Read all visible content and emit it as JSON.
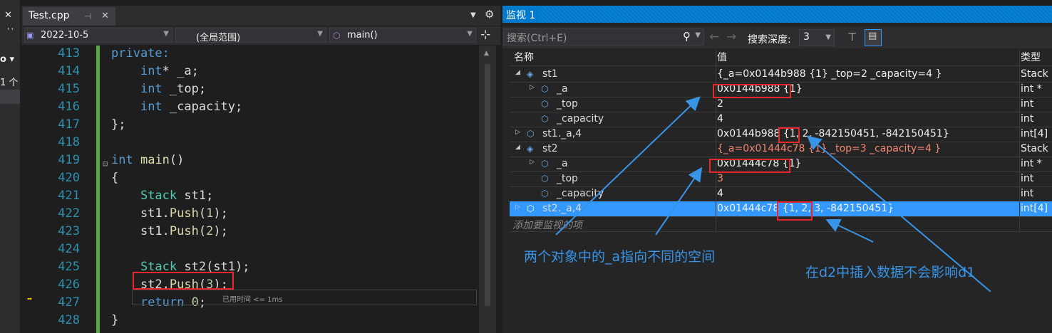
{
  "left_strip": {
    "glyph1": "✕",
    "glyph2": "' '",
    "glyph3": "o ▾",
    "glyph4": "1 个"
  },
  "editor": {
    "tab_title": "Test.cpp",
    "tab_pin": "⊣",
    "tab_close": "✕",
    "nav_file": "2022-10-5",
    "nav_scope": "(全局范围)",
    "nav_func": "main()",
    "lines": [
      {
        "num": "413",
        "segs": [
          {
            "t": "private:",
            "c": "kw"
          }
        ]
      },
      {
        "num": "414",
        "segs": [
          {
            "t": "    ",
            "c": ""
          },
          {
            "t": "int",
            "c": "kw"
          },
          {
            "t": "* _a;",
            "c": ""
          }
        ]
      },
      {
        "num": "415",
        "segs": [
          {
            "t": "    ",
            "c": ""
          },
          {
            "t": "int",
            "c": "kw"
          },
          {
            "t": " _top;",
            "c": ""
          }
        ]
      },
      {
        "num": "416",
        "segs": [
          {
            "t": "    ",
            "c": ""
          },
          {
            "t": "int",
            "c": "kw"
          },
          {
            "t": " _capacity;",
            "c": ""
          }
        ]
      },
      {
        "num": "417",
        "segs": [
          {
            "t": "};",
            "c": ""
          }
        ]
      },
      {
        "num": "418",
        "segs": []
      },
      {
        "num": "419",
        "segs": [
          {
            "t": "int",
            "c": "kw"
          },
          {
            "t": " ",
            "c": ""
          },
          {
            "t": "main",
            "c": "fn"
          },
          {
            "t": "()",
            "c": ""
          }
        ]
      },
      {
        "num": "420",
        "segs": [
          {
            "t": "{",
            "c": ""
          }
        ]
      },
      {
        "num": "421",
        "segs": [
          {
            "t": "    ",
            "c": ""
          },
          {
            "t": "Stack",
            "c": "ty"
          },
          {
            "t": " st1;",
            "c": ""
          }
        ]
      },
      {
        "num": "422",
        "segs": [
          {
            "t": "    st1.",
            "c": ""
          },
          {
            "t": "Push",
            "c": "fn"
          },
          {
            "t": "(",
            "c": ""
          },
          {
            "t": "1",
            "c": "nm"
          },
          {
            "t": ");",
            "c": ""
          }
        ]
      },
      {
        "num": "423",
        "segs": [
          {
            "t": "    st1.",
            "c": ""
          },
          {
            "t": "Push",
            "c": "fn"
          },
          {
            "t": "(",
            "c": ""
          },
          {
            "t": "2",
            "c": "nm"
          },
          {
            "t": ");",
            "c": ""
          }
        ]
      },
      {
        "num": "424",
        "segs": []
      },
      {
        "num": "425",
        "segs": [
          {
            "t": "    ",
            "c": ""
          },
          {
            "t": "Stack",
            "c": "ty"
          },
          {
            "t": " st2(st1);",
            "c": ""
          }
        ]
      },
      {
        "num": "426",
        "segs": [
          {
            "t": "    st2.",
            "c": ""
          },
          {
            "t": "Push",
            "c": "fn"
          },
          {
            "t": "(",
            "c": ""
          },
          {
            "t": "3",
            "c": "nm"
          },
          {
            "t": ");",
            "c": ""
          }
        ]
      },
      {
        "num": "427",
        "segs": [
          {
            "t": "    ",
            "c": ""
          },
          {
            "t": "return",
            "c": "kw"
          },
          {
            "t": " ",
            "c": ""
          },
          {
            "t": "0",
            "c": "nm"
          },
          {
            "t": ";",
            "c": ""
          }
        ]
      },
      {
        "num": "428",
        "segs": [
          {
            "t": "}",
            "c": ""
          }
        ]
      }
    ],
    "perf_tip": "已用时间 <= 1ms"
  },
  "watch": {
    "title": "监视 1",
    "search_placeholder": "搜索(Ctrl+E)",
    "search_icon": "⚲",
    "depth_label": "搜索深度:",
    "depth_value": "3",
    "col_name": "名称",
    "col_value": "值",
    "col_type": "类型",
    "rows": [
      {
        "name": "st1",
        "value": "{_a=0x0144b988 {1} _top=2 _capacity=4 }",
        "type": "Stack",
        "level": 0,
        "expander": "◢",
        "icon": "◈",
        "changed": false,
        "selected": false
      },
      {
        "name": "_a",
        "value": "0x0144b988 {1}",
        "type": "int *",
        "level": 1,
        "expander": "▷",
        "icon": "⬡",
        "changed": false,
        "selected": false
      },
      {
        "name": "_top",
        "value": "2",
        "type": "int",
        "level": 1,
        "expander": "",
        "icon": "⬡",
        "changed": false,
        "selected": false
      },
      {
        "name": "_capacity",
        "value": "4",
        "type": "int",
        "level": 1,
        "expander": "",
        "icon": "⬡",
        "changed": false,
        "selected": false
      },
      {
        "name": "st1._a,4",
        "value": "0x0144b988 {1, 2, -842150451, -842150451}",
        "type": "int[4]",
        "level": 0,
        "expander": "▷",
        "icon": "⬡",
        "changed": false,
        "selected": false
      },
      {
        "name": "st2",
        "value": "{_a=0x01444c78 {1} _top=3 _capacity=4 }",
        "type": "Stack",
        "level": 0,
        "expander": "◢",
        "icon": "◈",
        "changed": true,
        "selected": false
      },
      {
        "name": "_a",
        "value": "0x01444c78 {1}",
        "type": "int *",
        "level": 1,
        "expander": "▷",
        "icon": "⬡",
        "changed": false,
        "selected": false
      },
      {
        "name": "_top",
        "value": "3",
        "type": "int",
        "level": 1,
        "expander": "",
        "icon": "⬡",
        "changed": true,
        "selected": false
      },
      {
        "name": "_capacity",
        "value": "4",
        "type": "int",
        "level": 1,
        "expander": "",
        "icon": "⬡",
        "changed": false,
        "selected": false
      },
      {
        "name": "st2._a,4",
        "value": "0x01444c78 {1, 2, 3, -842150451}",
        "type": "int[4]",
        "level": 0,
        "expander": "▷",
        "icon": "⬡",
        "changed": false,
        "selected": true
      }
    ],
    "add_item_placeholder": "添加要监视的项"
  },
  "annotations": {
    "left_text": "两个对象中的_a指向不同的空间",
    "right_text": "在d2中插入数据不会影响d1",
    "color": "#3794e6"
  },
  "colors": {
    "accent": "#007acc",
    "selection": "#3399ff",
    "highlight_box": "#e8262b",
    "changed_value": "#f48771"
  }
}
